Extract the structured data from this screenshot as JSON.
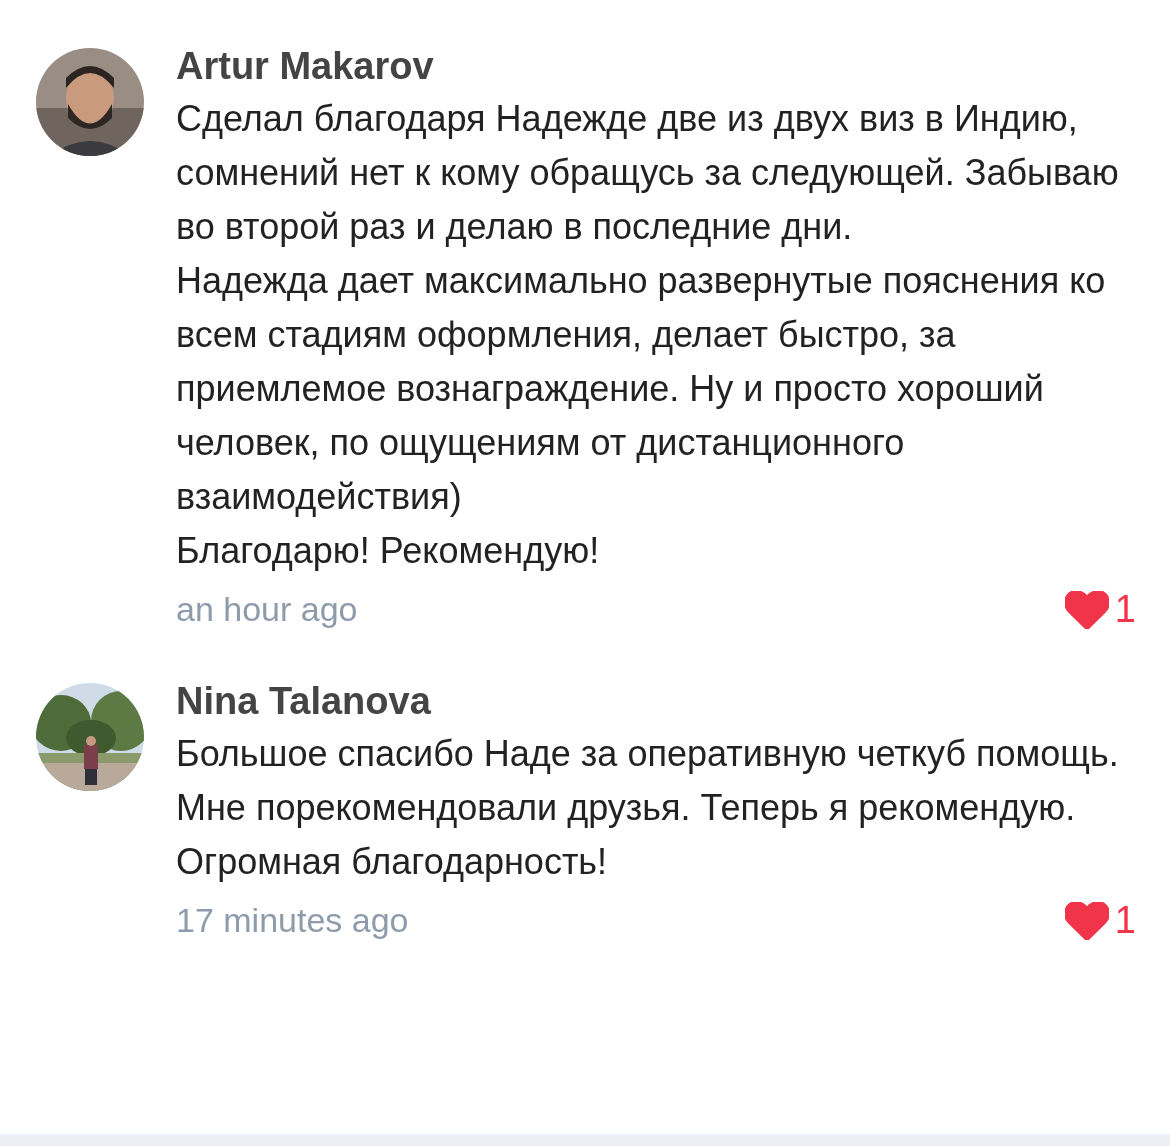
{
  "comments": [
    {
      "author": "Artur Makarov",
      "avatar": {
        "kind": "picture"
      },
      "paragraphs": [
        "Сделал благодаря Надежде две из двух виз в Индию, сомнений нет к кому обращусь за следующей. Забываю во второй раз и делаю в последние дни.",
        "Надежда дает максимально развернутые пояснения ко всем стадиям оформления, делает быстро, за приемлемое вознаграждение. Ну и просто хороший человек, по ощущениям от дистанционного взаимодействия)",
        "Благодарю! Рекомендую!"
      ],
      "time": "an hour ago",
      "likes": "1",
      "liked": true
    },
    {
      "author": "Nina Talanova",
      "avatar": {
        "kind": "picture"
      },
      "paragraphs": [
        "Большое спасибо Наде за оперативную четкуб помощь. Мне порекомендовали друзья. Теперь я рекомендую. Огромная благодарность!"
      ],
      "time": "17 minutes ago",
      "likes": "1",
      "liked": true
    }
  ]
}
